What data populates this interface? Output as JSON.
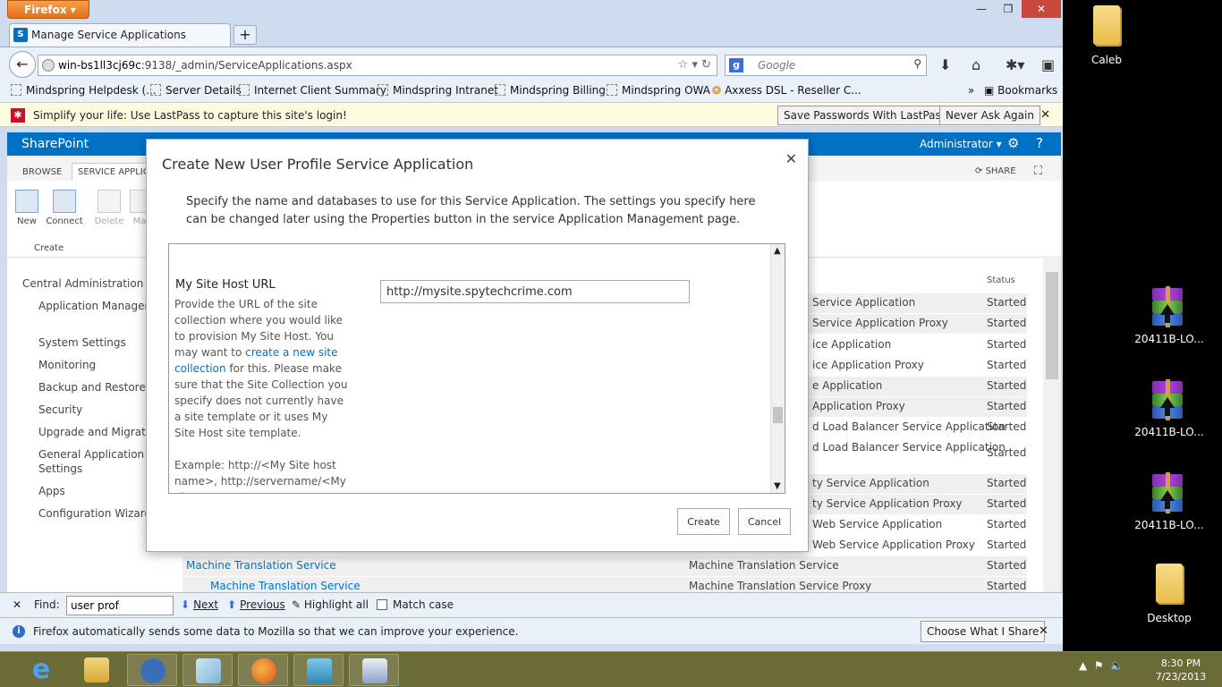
{
  "browser": {
    "app_button": "Firefox",
    "tab_title": "Manage Service Applications",
    "url_host": "win-bs1ll3cj69c",
    "url_path": ":9138/_admin/ServiceApplications.aspx",
    "search_placeholder": "Google",
    "bookmarks": [
      "Mindspring Helpdesk (...",
      "Server Details",
      "Internet Client Summary",
      "Mindspring Intranet",
      "Mindspring Billing",
      "Mindspring OWA",
      "Axxess DSL - Reseller C..."
    ],
    "bookmarks_menu": "Bookmarks"
  },
  "lastpass": {
    "message": "Simplify your life: Use LastPass to capture this site's login!",
    "save_label": "Save Passwords With LastPass",
    "never_label": "Never Ask Again"
  },
  "sharepoint": {
    "brand": "SharePoint",
    "user": "Administrator",
    "share_label": "SHARE",
    "ribbon_tabs": [
      "BROWSE",
      "SERVICE APPLICA"
    ],
    "ribbon_items": [
      "New",
      "Connect",
      "Delete",
      "Mar"
    ],
    "ribbon_group": "Create",
    "quicklaunch_head": "Central Administration",
    "quicklaunch": [
      "Application Management",
      "System Settings",
      "Monitoring",
      "Backup and Restore",
      "Security",
      "Upgrade and Migration",
      "General Application Settings",
      "Apps",
      "Configuration Wizards"
    ],
    "status_header": "Status",
    "services": [
      {
        "name": "Service Application",
        "status": "Started"
      },
      {
        "name": "Service Application Proxy",
        "status": "Started"
      },
      {
        "name": "ice Application",
        "status": "Started"
      },
      {
        "name": "ice Application Proxy",
        "status": "Started"
      },
      {
        "name": "e Application",
        "status": "Started"
      },
      {
        "name": "Application Proxy",
        "status": "Started"
      },
      {
        "name": "d Load Balancer Service Application",
        "status": "Started"
      },
      {
        "name": "d Load Balancer Service Application",
        "status": "Started"
      },
      {
        "name": "ty Service Application",
        "status": "Started"
      },
      {
        "name": "ty Service Application Proxy",
        "status": "Started"
      },
      {
        "name": "Web Service Application",
        "status": "Started"
      },
      {
        "name": "Web Service Application Proxy",
        "status": "Started"
      },
      {
        "name": "Machine Translation Service",
        "status": "Started",
        "link": "Machine Translation Service"
      },
      {
        "name": "Machine Translation Service Proxy",
        "status": "Started",
        "link": "Machine Translation Service"
      }
    ]
  },
  "dialog": {
    "title": "Create New User Profile Service Application",
    "intro": "Specify the name and databases to use for this Service Application. The settings you specify here can be changed later using the Properties button in the service Application Management page.",
    "field_label": "My Site Host URL",
    "field_desc_1": "Provide the URL of the site collection where you would like to provision My Site Host. You may want to",
    "field_desc_link": "create a new site collection",
    "field_desc_2": "for this. Please make sure that the Site Collection you specify does not currently have a site template or it uses My Site Host site template.",
    "example": "Example: http://<My Site host name>, http://servername/<My Site Host Name>, etc.",
    "field_value": "http://mysite.spytechcrime.com",
    "create_label": "Create",
    "cancel_label": "Cancel"
  },
  "findbar": {
    "label": "Find:",
    "value": "user prof",
    "next": "Next",
    "previous": "Previous",
    "highlight": "Highlight all",
    "match_case": "Match case"
  },
  "notification": {
    "message": "Firefox automatically sends some data to Mozilla so that we can improve your experience.",
    "button": "Choose What I Share"
  },
  "desktop": {
    "icons": [
      "Caleb",
      "20411B-LO...",
      "20411B-LO...",
      "20411B-LO...",
      "Desktop"
    ]
  },
  "taskbar": {
    "time": "8:30 PM",
    "date": "7/23/2013"
  }
}
